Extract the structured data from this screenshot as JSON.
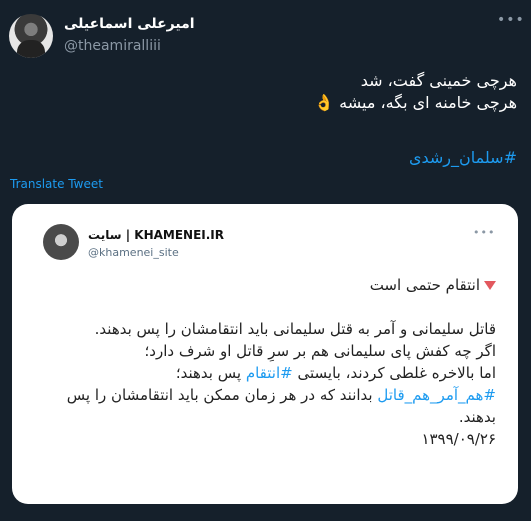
{
  "author": {
    "name": "امیرعلی اسماعیلی",
    "handle": "@theamiralliii"
  },
  "tweet": {
    "line1": "هرچی خمینی گفت، شد",
    "line2": "هرچی خامنه ای بگه، میشه",
    "emoji": "👌",
    "hashtag": "#سلمان_رشدی",
    "translate": "Translate Tweet"
  },
  "embed": {
    "name": "KHAMENEI.IR | سایت",
    "handle": "@khamenei_site",
    "heading": "انتقام حتمی است",
    "p1": "قاتل سلیمانی و آمر به قتل سلیمانی باید انتقامشان را پس بدهند.",
    "p2a": "اگر چه کفش پای سلیمانی هم بر سرِ قاتل او شرف دارد؛",
    "p2b": "اما بالاخره غلطی کردند، بایستی",
    "p2_tag": "#انتقام",
    "p2c": "پس بدهند؛",
    "p3_tag": "#هم_آمر_هم_قاتل",
    "p3a": "بدانند که در هر زمان ممکن باید انتقامشان را پس بدهند.",
    "date": "۱۳۹۹/۰۹/۲۶"
  },
  "icons": {
    "more": "more-icon",
    "ok_hand": "ok-hand-icon",
    "alert_triangle": "alert-triangle-icon"
  }
}
